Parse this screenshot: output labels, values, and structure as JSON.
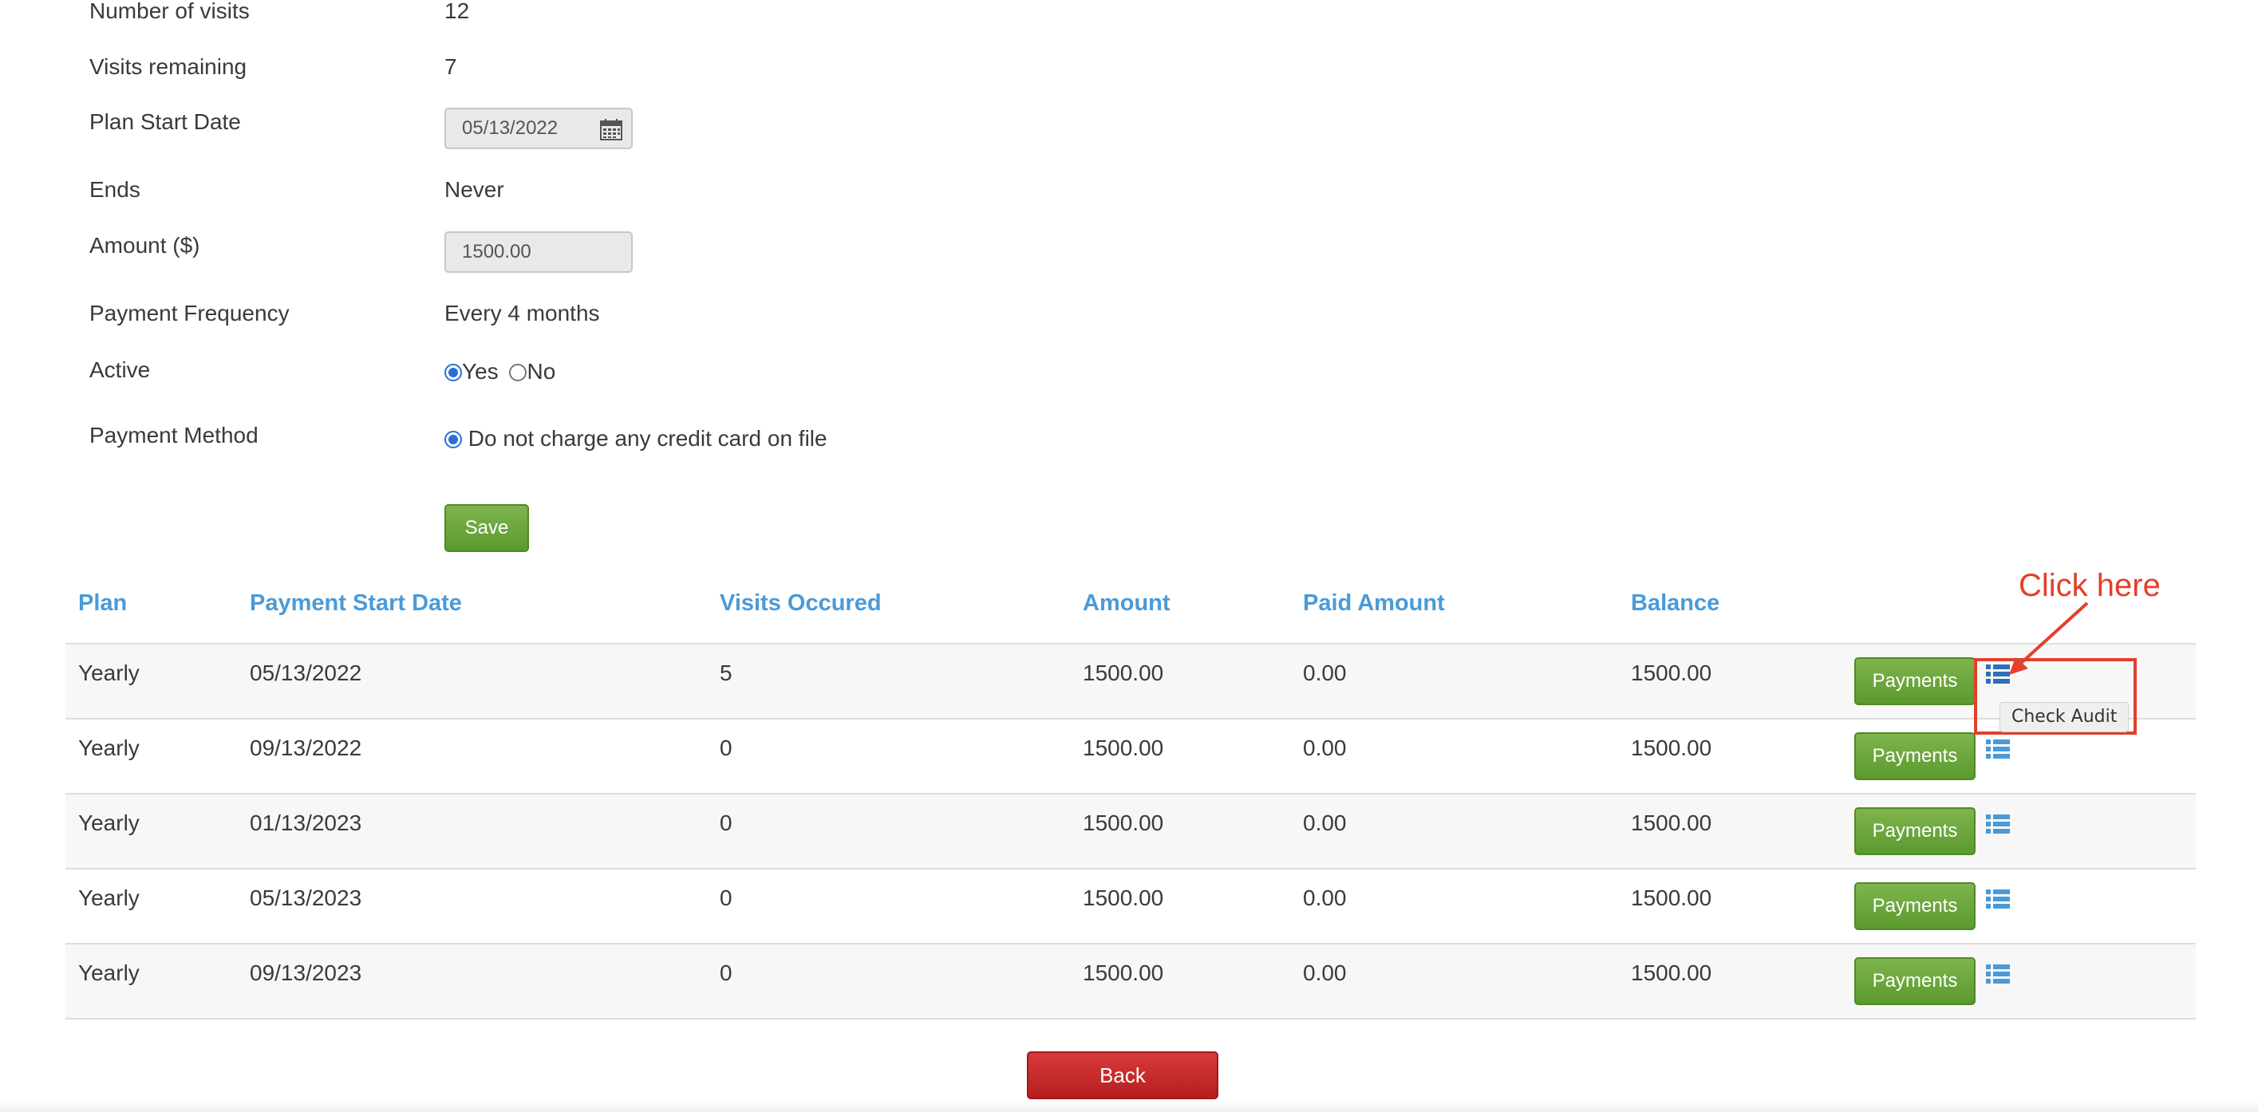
{
  "form": {
    "number_of_visits": {
      "label": "Number of visits",
      "value": "12"
    },
    "visits_remaining": {
      "label": "Visits remaining",
      "value": "7"
    },
    "plan_start_date": {
      "label": "Plan Start Date",
      "value": "05/13/2022"
    },
    "ends": {
      "label": "Ends",
      "value": "Never"
    },
    "amount": {
      "label": "Amount ($)",
      "value": "1500.00"
    },
    "payment_frequency": {
      "label": "Payment Frequency",
      "value": "Every 4 months"
    },
    "active": {
      "label": "Active",
      "yes_label": "Yes",
      "no_label": "No",
      "selected": "Yes"
    },
    "payment_method": {
      "label": "Payment Method",
      "option_label": "Do not charge any credit card on file",
      "selected": true
    },
    "save_label": "Save"
  },
  "table": {
    "headers": [
      "Plan",
      "Payment Start Date",
      "Visits Occured",
      "Amount",
      "Paid Amount",
      "Balance"
    ],
    "rows": [
      {
        "plan": "Yearly",
        "start_date": "05/13/2022",
        "visits": "5",
        "amount": "1500.00",
        "paid": "0.00",
        "balance": "1500.00",
        "action": "Payments"
      },
      {
        "plan": "Yearly",
        "start_date": "09/13/2022",
        "visits": "0",
        "amount": "1500.00",
        "paid": "0.00",
        "balance": "1500.00",
        "action": "Payments"
      },
      {
        "plan": "Yearly",
        "start_date": "01/13/2023",
        "visits": "0",
        "amount": "1500.00",
        "paid": "0.00",
        "balance": "1500.00",
        "action": "Payments"
      },
      {
        "plan": "Yearly",
        "start_date": "05/13/2023",
        "visits": "0",
        "amount": "1500.00",
        "paid": "0.00",
        "balance": "1500.00",
        "action": "Payments"
      },
      {
        "plan": "Yearly",
        "start_date": "09/13/2023",
        "visits": "0",
        "amount": "1500.00",
        "paid": "0.00",
        "balance": "1500.00",
        "action": "Payments"
      }
    ]
  },
  "annotation": {
    "text": "Click here",
    "tooltip": "Check Audit",
    "color": "#e53e2a"
  },
  "back_label": "Back",
  "icons": {
    "calendar": "calendar-icon",
    "audit": "list-icon"
  },
  "colors": {
    "header_text": "#4a9ad8",
    "green_button": "#5b9a2e",
    "red_button": "#b51e1e",
    "radio": "#2a6fd8"
  }
}
